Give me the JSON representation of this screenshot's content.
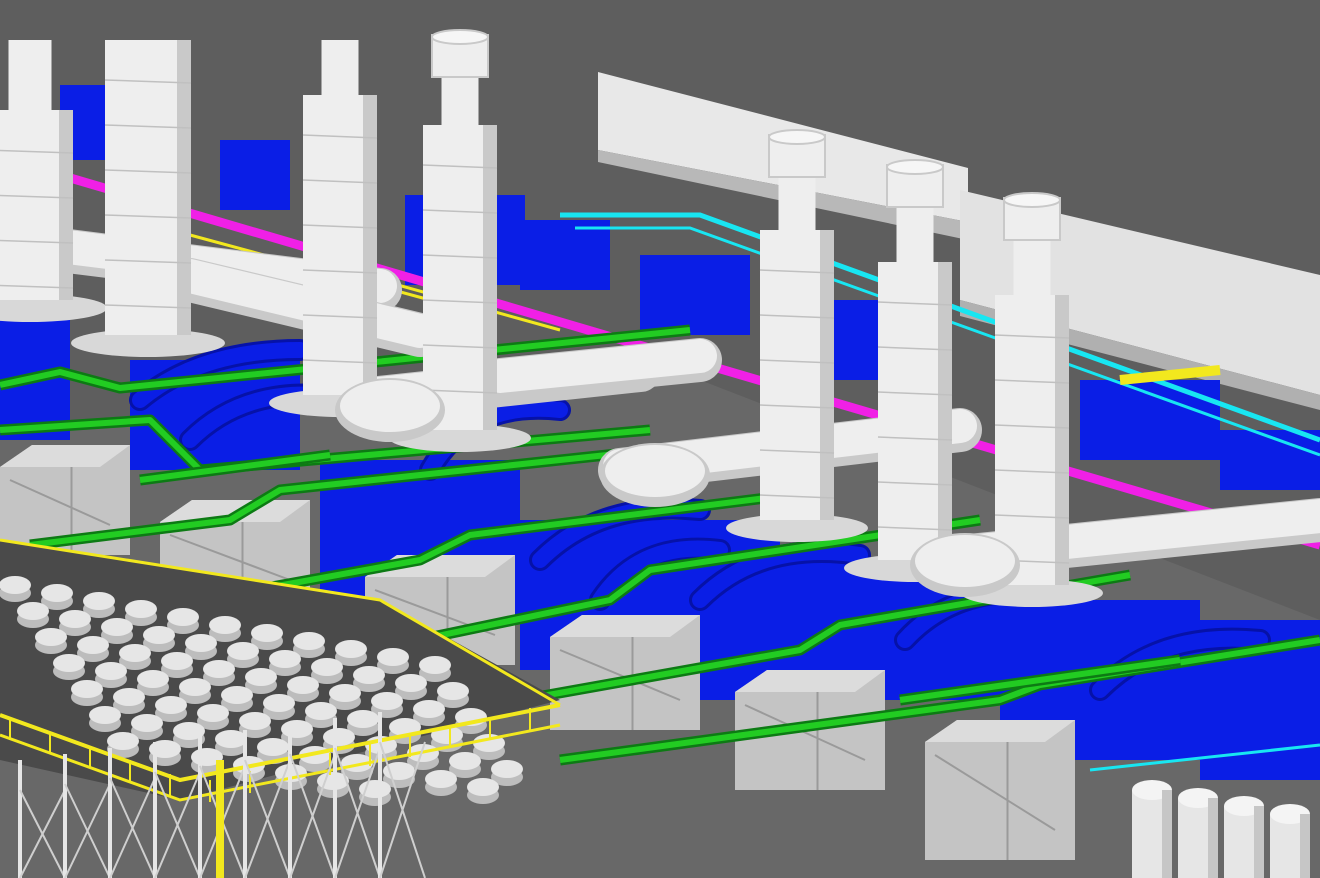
{
  "scene": {
    "colors": {
      "background": "#5e5e5e",
      "floor": "#6a6a6a",
      "equipment_white": "#eeeeee",
      "equipment_shade": "#c9c9c9",
      "pipe_blue": "#0a1ee6",
      "pipe_blue_dark": "#0612a8",
      "pipe_green": "#22cc22",
      "pipe_green_dark": "#0d7a14",
      "pipe_magenta": "#f020e6",
      "pipe_cyan": "#18e6f2",
      "handrail_yellow": "#f2e81e",
      "skid_gray": "#c4c4c4",
      "skid_gray_dark": "#9a9a9a",
      "structure_white": "#e6e6e6"
    },
    "components": {
      "generators": [
        "white-stack-generator",
        "white-stack-generator",
        "white-stack-generator",
        "white-stack-generator",
        "white-stack-generator",
        "white-stack-generator",
        "white-stack-generator"
      ],
      "piping": [
        "blue-pipe-header",
        "green-pipe-run",
        "magenta-pipe-run",
        "cyan-pipe-run"
      ],
      "structures": [
        "yellow-handrail",
        "white-support-frame",
        "gray-equipment-skid",
        "white-storage-tank"
      ]
    }
  }
}
